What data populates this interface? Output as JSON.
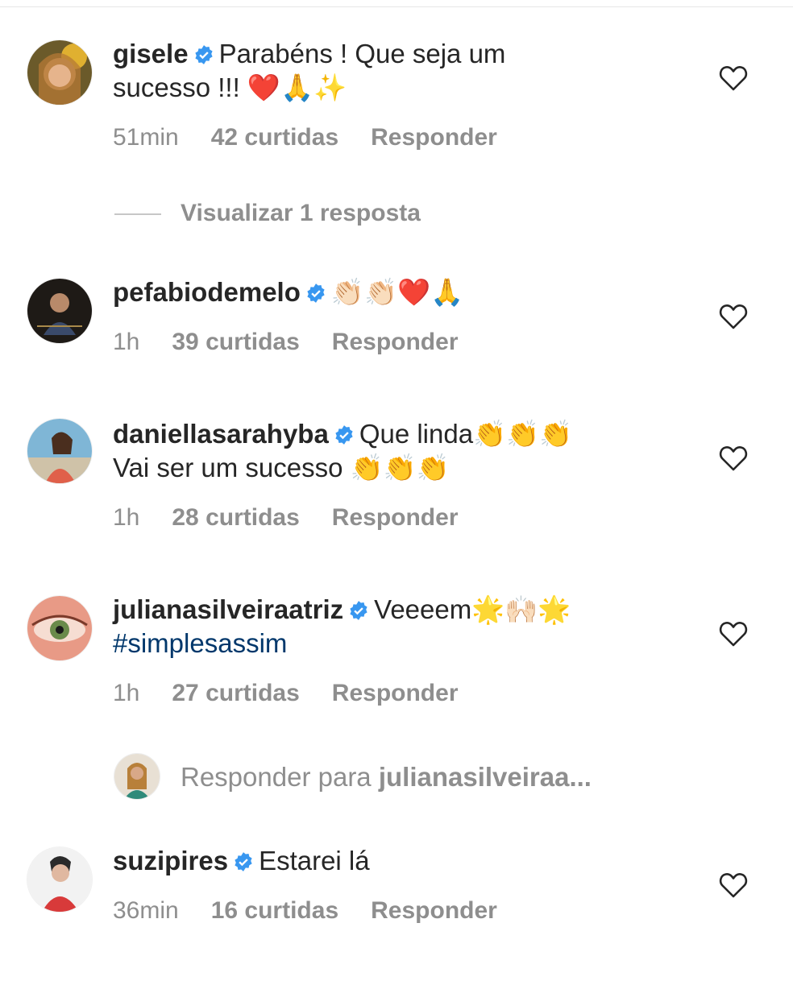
{
  "comments": [
    {
      "username": "gisele",
      "line1": "Parabéns ! Que seja um",
      "line2": "sucesso !!!",
      "emojis_line2": "❤️🙏✨",
      "time": "51min",
      "likes": "42 curtidas",
      "reply": "Responder"
    },
    {
      "username": "pefabiodemelo",
      "emojis": "👏🏻👏🏻❤️🙏",
      "time": "1h",
      "likes": "39 curtidas",
      "reply": "Responder"
    },
    {
      "username": "daniellasarahyba",
      "line1": "Que linda",
      "emojis_line1": "👏👏👏",
      "line2": "Vai ser um sucesso",
      "emojis_line2": "👏👏👏",
      "time": "1h",
      "likes": "28 curtidas",
      "reply": "Responder"
    },
    {
      "username": "julianasilveiraatriz",
      "line1": "Veeeem",
      "emojis_line1": "🌟🙌🏻🌟",
      "hashtag": "#simplesassim",
      "time": "1h",
      "likes": "27 curtidas",
      "reply": "Responder"
    },
    {
      "username": "suzipires",
      "line1": "Estarei lá",
      "time": "36min",
      "likes": "16 curtidas",
      "reply": "Responder"
    }
  ],
  "view_replies": "Visualizar 1 resposta",
  "reply_prompt": {
    "prefix": "Responder para",
    "target": "julianasilveiraa..."
  },
  "icons": {
    "verified": "verified-badge-icon",
    "like": "heart-outline-icon"
  },
  "colors": {
    "verified_blue": "#3897f0",
    "muted_text": "#8e8e8e",
    "hashtag": "#00376b"
  }
}
